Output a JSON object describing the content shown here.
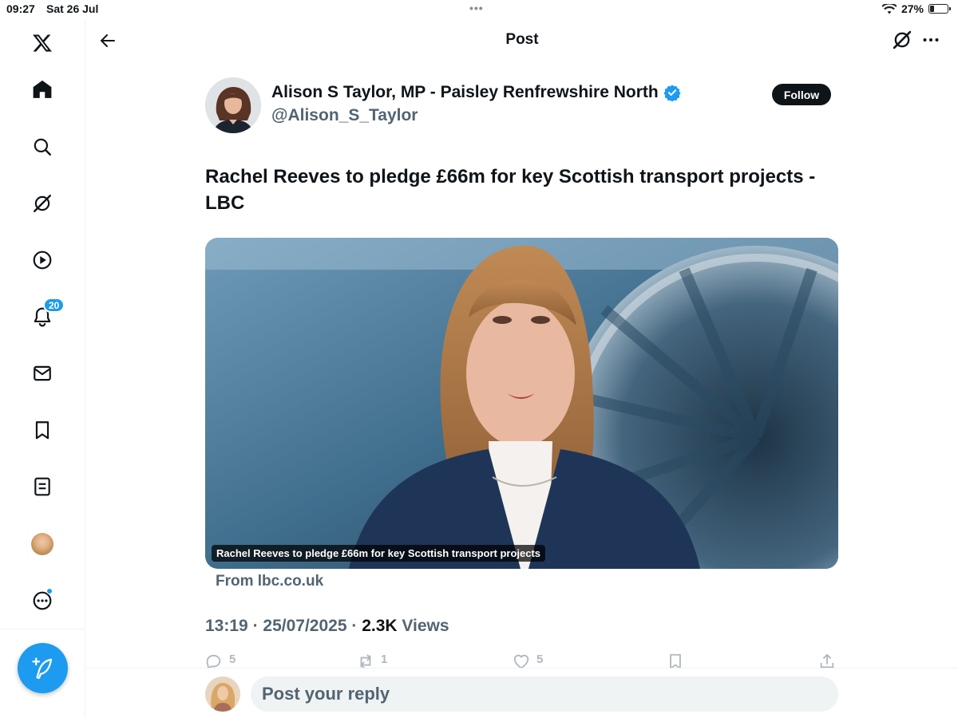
{
  "status_bar": {
    "time": "09:27",
    "date": "Sat 26 Jul",
    "battery": "27%",
    "battery_level": 0.27
  },
  "header": {
    "title": "Post",
    "icons": [
      "back-arrow-icon",
      "grok-icon",
      "more-icon"
    ]
  },
  "sidebar": {
    "items": [
      {
        "name": "x-logo",
        "icon": "x-logo-icon"
      },
      {
        "name": "home",
        "icon": "home-icon"
      },
      {
        "name": "explore",
        "icon": "search-icon"
      },
      {
        "name": "grok",
        "icon": "grok-icon"
      },
      {
        "name": "video",
        "icon": "play-icon"
      },
      {
        "name": "notifications",
        "icon": "bell-icon",
        "badge": "20"
      },
      {
        "name": "messages",
        "icon": "mail-icon"
      },
      {
        "name": "bookmarks",
        "icon": "bookmark-icon"
      },
      {
        "name": "lists",
        "icon": "list-icon"
      },
      {
        "name": "profile",
        "icon": "avatar"
      },
      {
        "name": "more",
        "icon": "more-circle-icon"
      }
    ],
    "compose_icon": "compose-quill-icon"
  },
  "post": {
    "author_name": "Alison S Taylor, MP - Paisley Renfrewshire North",
    "author_handle": "@Alison_S_Taylor",
    "follow_label": "Follow",
    "text": "Rachel Reeves to pledge £66m for key Scottish transport projects - LBC",
    "card": {
      "caption": "Rachel Reeves to pledge £66m for key Scottish transport projects",
      "domain": "From lbc.co.uk"
    },
    "time": "13:19",
    "date": "25/07/2025",
    "views_count": "2.3K",
    "views_label": "Views",
    "sep": "·",
    "actions": {
      "replies": "5",
      "reposts": "1",
      "likes": "5"
    }
  },
  "reply": {
    "placeholder": "Post your reply"
  },
  "colors": {
    "accent": "#1d9bf0",
    "text": "#0f1419",
    "muted": "#536471"
  }
}
